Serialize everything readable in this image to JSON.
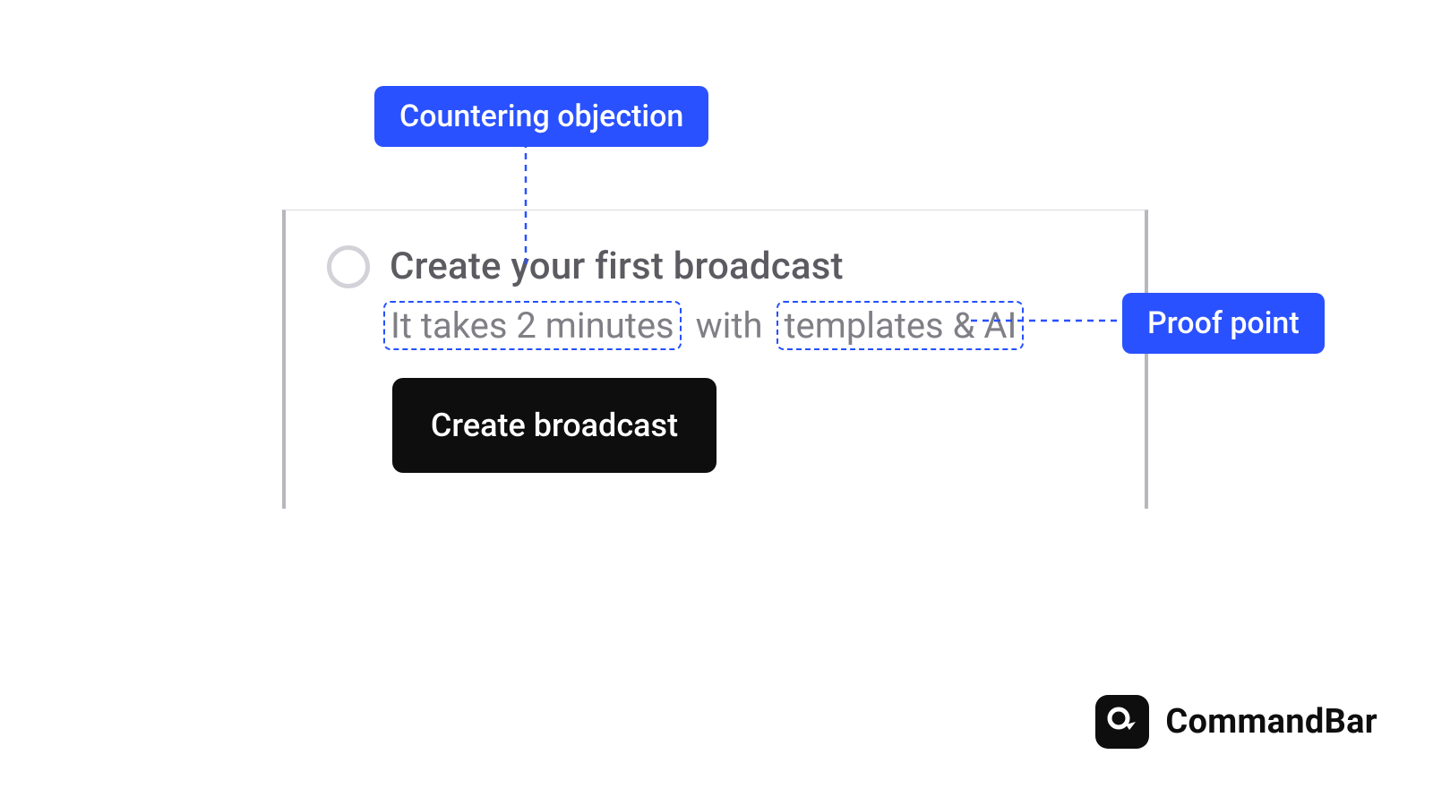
{
  "annotations": {
    "top_label": "Countering objection",
    "right_label": "Proof point"
  },
  "card": {
    "title": "Create your first broadcast",
    "subtitle_part1": "It takes 2 minutes",
    "subtitle_mid": "with",
    "subtitle_part2": "templates & AI",
    "cta_label": "Create broadcast"
  },
  "brand": {
    "name": "CommandBar"
  },
  "colors": {
    "accent": "#2a51ff",
    "ink": "#0e0e0f",
    "muted": "#7f7f86",
    "card_border": "#b7b7bd"
  }
}
